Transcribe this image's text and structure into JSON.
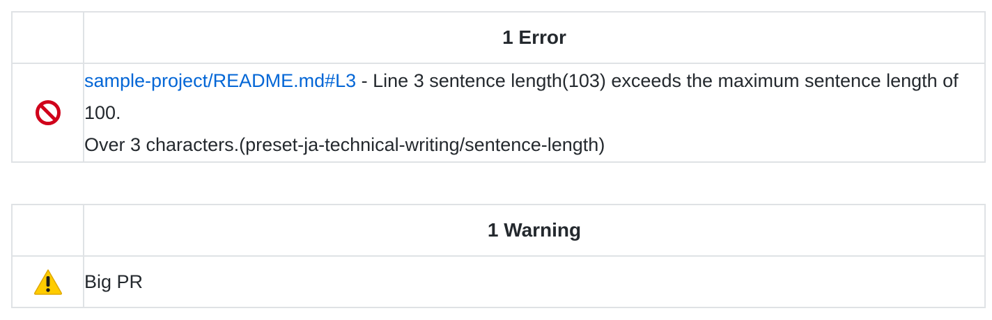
{
  "errors": {
    "header": "1 Error",
    "items": [
      {
        "icon": "no-entry-sign-icon",
        "link_text": "sample-project/README.md#L3",
        "message_line1": " - Line 3 sentence length(103) exceeds the maximum sentence length of 100.",
        "message_line2": "Over 3 characters.(preset-ja-technical-writing/sentence-length)"
      }
    ]
  },
  "warnings": {
    "header": "1 Warning",
    "items": [
      {
        "icon": "warning-icon",
        "message": "Big PR"
      }
    ]
  },
  "colors": {
    "link": "#0366d6",
    "border": "#dfe2e5",
    "error_icon": "#d0021b",
    "warning_icon": "#ffcc00",
    "text": "#24292e"
  }
}
